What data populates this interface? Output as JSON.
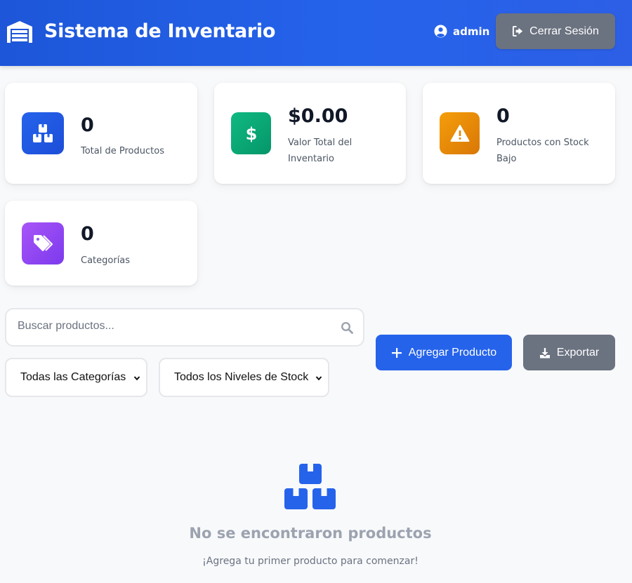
{
  "header": {
    "title": "Sistema de Inventario",
    "brand_icon": "warehouse-icon",
    "user_icon": "user-circle-icon",
    "username": "admin",
    "logout_label": "Cerrar Sesión",
    "logout_icon": "sign-out-icon"
  },
  "stats": {
    "total_products": {
      "value": "0",
      "label": "Total de Productos",
      "icon": "boxes-icon",
      "color": "#2563eb"
    },
    "inventory_value": {
      "value": "$0.00",
      "label_line1": "Valor Total del",
      "label_line2": "Inventario",
      "icon": "dollar-icon",
      "color": "#10b981"
    },
    "low_stock": {
      "value": "0",
      "label_line1": "Productos con Stock",
      "label_line2": "Bajo",
      "icon": "warning-icon",
      "color": "#f59e0b"
    },
    "categories": {
      "value": "0",
      "label": "Categorías",
      "icon": "tags-icon",
      "color": "#8b5cf6"
    }
  },
  "controls": {
    "search_placeholder": "Buscar productos...",
    "search_value": "",
    "category_filter": "Todas las Categorías",
    "stock_filter": "Todos los Niveles de Stock",
    "add_button": "Agregar Producto",
    "export_button": "Exportar"
  },
  "empty_state": {
    "icon": "boxes-icon",
    "title": "No se encontraron productos",
    "subtitle": "¡Agrega tu primer producto para comenzar!"
  },
  "colors": {
    "header": "#2563eb",
    "primary": "#2563eb",
    "secondary": "#6b7280"
  }
}
